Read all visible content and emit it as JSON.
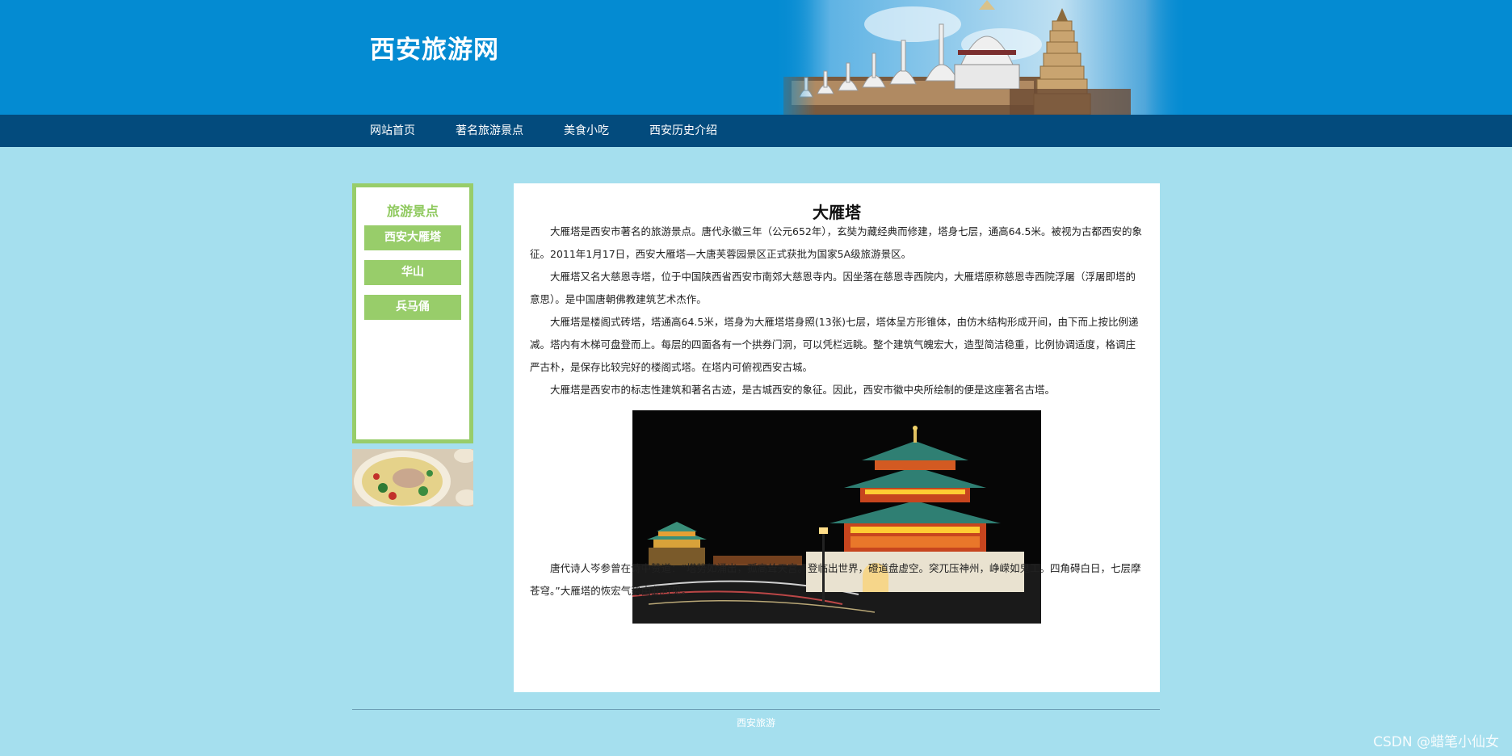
{
  "header": {
    "site_title": "西安旅游网"
  },
  "nav": {
    "items": [
      "网站首页",
      "著名旅游景点",
      "美食小吃",
      "西安历史介绍"
    ]
  },
  "sidebar": {
    "title": "旅游景点",
    "items": [
      "西安大雁塔",
      "华山",
      "兵马俑"
    ]
  },
  "article": {
    "title": "大雁塔",
    "paragraphs": [
      "大雁塔是西安市著名的旅游景点。唐代永徽三年（公元652年），玄奘为藏经典而修建，塔身七层，通高64.5米。被视为古都西安的象征。2011年1月17日，西安大雁塔—大唐芙蓉园景区正式获批为国家5A级旅游景区。",
      "大雁塔又名大慈恩寺塔，位于中国陕西省西安市南郊大慈恩寺内。因坐落在慈恩寺西院内，大雁塔原称慈恩寺西院浮屠（浮屠即塔的意思）。是中国唐朝佛教建筑艺术杰作。",
      "大雁塔是楼阁式砖塔，塔通高64.5米，塔身为大雁塔塔身照(13张)七层，塔体呈方形锥体，由仿木结构形成开间，由下而上按比例递减。塔内有木梯可盘登而上。每层的四面各有一个拱券门洞，可以凭栏远眺。整个建筑气魄宏大，造型简洁稳重，比例协调适度，格调庄严古朴，是保存比较完好的楼阁式塔。在塔内可俯视西安古城。",
      "大雁塔是西安市的标志性建筑和著名古迹，是古城西安的象征。因此，西安市徽中央所绘制的便是这座著名古塔。",
      "唐代诗人岑参曾在诗中赞道：“塔势如涌出，孤高耸天宫。登临出世界，磴道盘虚空。突兀压神州，峥嵘如鬼工。四角碍白日，七层摩苍穹。”大雁塔的恢宏气势由此可见。"
    ]
  },
  "footer": {
    "text": "西安旅游"
  },
  "watermark": "CSDN @蜡笔小仙女",
  "colors": {
    "header_bg": "#048bd2",
    "nav_bg": "#034b7d",
    "page_bg": "#a5dfee",
    "accent_green": "#98cd6a"
  }
}
